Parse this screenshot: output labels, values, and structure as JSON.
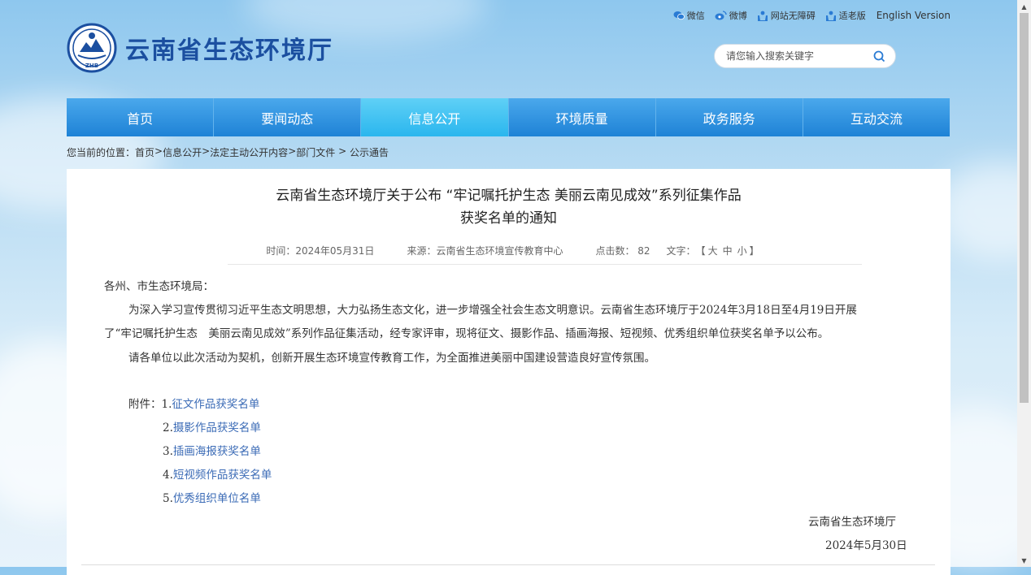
{
  "site": {
    "name": "云南省生态环境厅",
    "emblem_text": "ZHB"
  },
  "toplinks": [
    {
      "label": "微信",
      "icon": "wechat-icon"
    },
    {
      "label": "微博",
      "icon": "weibo-icon"
    },
    {
      "label": "网站无障碍",
      "icon": "accessibility-icon"
    },
    {
      "label": "适老版",
      "icon": "elderly-mode-icon"
    },
    {
      "label": "English Version"
    }
  ],
  "search": {
    "placeholder": "请您输入搜索关键字"
  },
  "nav": [
    "首页",
    "要闻动态",
    "信息公开",
    "环境质量",
    "政务服务",
    "互动交流"
  ],
  "breadcrumb": {
    "prefix": "您当前的位置：",
    "items": [
      "首页",
      "信息公开",
      "法定主动公开内容",
      "部门文件",
      "公示通告"
    ],
    "seps": [
      ">",
      ">",
      ">",
      " > "
    ]
  },
  "article": {
    "title_line1": "云南省生态环境厅关于公布 “牢记嘱托护生态 美丽云南见成效”系列征集作品",
    "title_line2": "获奖名单的通知",
    "meta": {
      "date": "时间：2024年05月31日",
      "source": "来源：云南省生态环境宣传教育中心",
      "clicks": "点击数： 82",
      "fontsize_label": "文字：",
      "fontsize_open": "【",
      "fs_large": "大",
      "fs_medium": "中",
      "fs_small": "小",
      "fontsize_close": "】"
    },
    "salutation": "各州、市生态环境局：",
    "para1_line1": "为深入学习宣传贯彻习近平生态文明思想，大力弘扬生态文化，进一步增强全社会生态文明意识。云南省生态环境厅于2024年3月18日至4月19日开展",
    "para1_line2": "了“牢记嘱托护生态　美丽云南见成效”系列作品征集活动，经专家评审，现将征文、摄影作品、插画海报、短视频、优秀组织单位获奖名单予以公布。",
    "para2": "请各单位以此次活动为契机，创新开展生态环境宣传教育工作，为全面推进美丽中国建设营造良好宣传氛围。",
    "attach_label": "附件：",
    "attachments": [
      {
        "num": "1.",
        "name": "征文作品获奖名单"
      },
      {
        "num": "2.",
        "name": "摄影作品获奖名单"
      },
      {
        "num": "3.",
        "name": "插画海报获奖名单"
      },
      {
        "num": "4.",
        "name": "短视频作品获奖名单"
      },
      {
        "num": "5.",
        "name": "优秀组织单位名单"
      }
    ],
    "signature": "云南省生态环境厅",
    "sign_date": "2024年5月30日"
  }
}
